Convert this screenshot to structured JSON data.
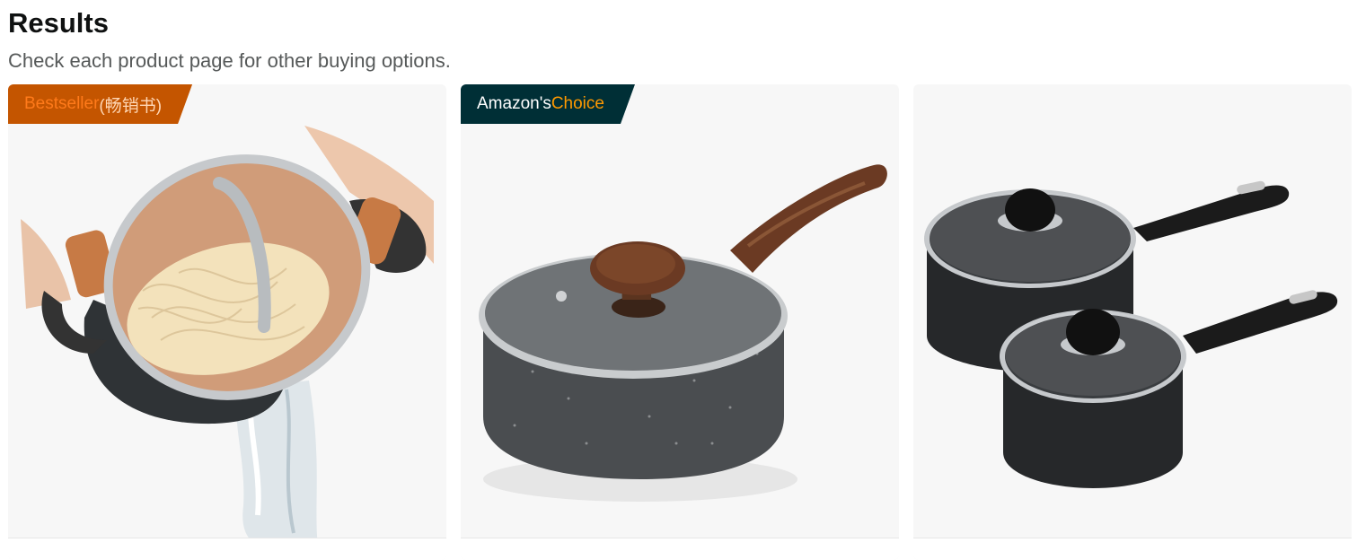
{
  "header": {
    "title": "Results",
    "subtitle": "Check each product page for other buying options."
  },
  "products": [
    {
      "badge_primary": "Bestseller",
      "badge_secondary": "(畅销书)",
      "image": "pasta-pot-with-strainer-lid",
      "colors": {
        "badge_bg": "#c45500",
        "badge_text": "#ff7a1a",
        "pot_body": "#2f3336",
        "copper": "#c77a45"
      }
    },
    {
      "badge_primary": "Amazon's ",
      "badge_secondary": "Choice",
      "image": "granite-saucepan-wood-handle",
      "colors": {
        "badge_bg": "#002f36",
        "badge_accent": "#ff9900",
        "pan_body": "#4a4d50",
        "wood": "#6b3a23"
      }
    },
    {
      "image": "two-black-saucepans-glass-lids",
      "colors": {
        "pan_body": "#26282a",
        "handle": "#1b1b1b"
      }
    }
  ]
}
